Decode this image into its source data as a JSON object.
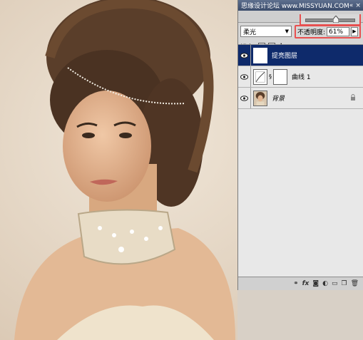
{
  "panel": {
    "title": "思缘设计论坛  www.MISSYUAN.COM",
    "blend_mode": "柔光",
    "opacity_label": "不透明度:",
    "opacity_value": "61%",
    "opacity_fraction": 0.61,
    "lock_label": "锁定:",
    "fill_label": "填充",
    "layers": [
      {
        "name": "提亮图层",
        "selected": true,
        "italic": false
      },
      {
        "name": "曲线 1",
        "selected": false,
        "italic": false
      },
      {
        "name": "背景",
        "selected": false,
        "italic": true
      }
    ],
    "bottom_icons": [
      "link-icon",
      "fx-icon",
      "mask-icon",
      "adjustment-icon",
      "group-icon",
      "new-layer-icon",
      "trash-icon"
    ]
  },
  "colors": {
    "selected_layer": "#0e2a6b",
    "highlight_box": "#e85050",
    "photo_background": "#e9dccb"
  }
}
